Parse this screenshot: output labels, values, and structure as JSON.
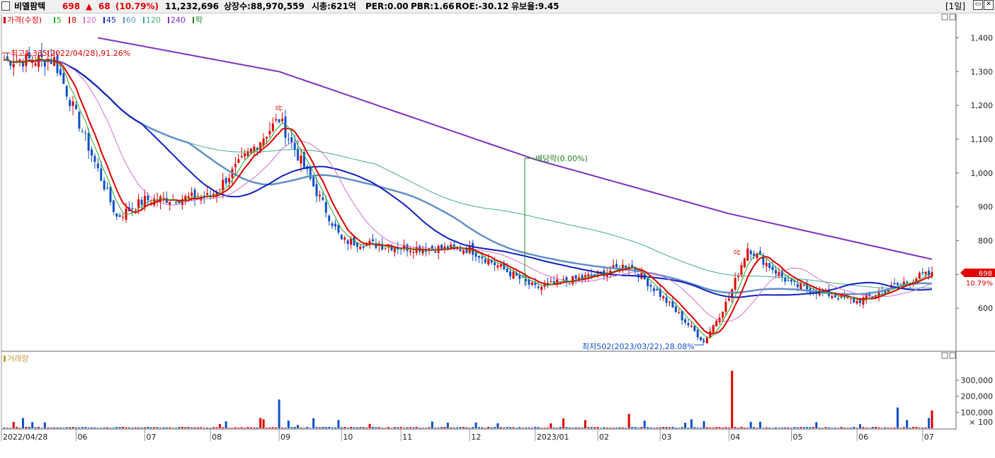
{
  "header": {
    "stock_name": "비엘팜텍",
    "price": "698",
    "change_symbol": "▲",
    "change": "68",
    "change_pct": "(10.79%)",
    "volume": "11,232,696",
    "listed_shares": "상장수:88,970,559",
    "market_cap": "시총:621억",
    "per": "PER:0.00",
    "pbr": "PBR:1.66",
    "roe": "ROE:-30.12",
    "float_ratio": "유보율:9.45",
    "period": "[1일]",
    "colors": {
      "up": "#e00000",
      "down": "#1050c8",
      "text": "#000000"
    }
  },
  "legend_price": {
    "label": "가격(수정)",
    "items": [
      {
        "label": "5",
        "color": "#22aa22"
      },
      {
        "label": "8",
        "color": "#e00000"
      },
      {
        "label": "20",
        "color": "#d070d0"
      },
      {
        "label": "45",
        "color": "#1020c0"
      },
      {
        "label": "60",
        "color": "#6090c8"
      },
      {
        "label": "120",
        "color": "#40b080"
      },
      {
        "label": "240",
        "color": "#8030c0"
      },
      {
        "label": "락",
        "color": "#208020"
      }
    ]
  },
  "legend_volume": {
    "label": "거래량"
  },
  "annotations": {
    "high": "최고1,335(2022/04/28),91.26%",
    "low": "최저502(2023/03/22),28.08%",
    "dividend": "배당락(0.00%)",
    "marker1": "상",
    "marker2": "상"
  },
  "price_tag": {
    "price": "698",
    "pct": "10.79%"
  },
  "chart_data": [
    {
      "type": "candlestick",
      "title": "",
      "y_ticks": [
        600,
        700,
        800,
        900,
        1000,
        1100,
        1200,
        1300,
        1400
      ],
      "ylim": [
        475,
        1470
      ],
      "x_tick_labels": [
        "2022/04/28",
        "06",
        "07",
        "08",
        "09",
        "10",
        "11",
        "12",
        "2023/01",
        "02",
        "03",
        "04",
        "05",
        "06",
        "07"
      ],
      "grid": false,
      "key_points": [
        {
          "date": "2022/04/28",
          "close": 1335
        },
        {
          "date": "2022/06",
          "close": 1170
        },
        {
          "date": "2022/06/20",
          "close": 870
        },
        {
          "date": "2022/07",
          "close": 920
        },
        {
          "date": "2022/08",
          "close": 930
        },
        {
          "date": "2022/09",
          "close": 1160
        },
        {
          "date": "2022/10",
          "close": 800
        },
        {
          "date": "2022/11",
          "close": 780
        },
        {
          "date": "2022/12",
          "close": 775
        },
        {
          "date": "2023/01",
          "close": 660
        },
        {
          "date": "2023/02",
          "close": 700
        },
        {
          "date": "2023/02/15",
          "close": 730
        },
        {
          "date": "2023/03",
          "close": 640
        },
        {
          "date": "2023/03/22",
          "close": 502
        },
        {
          "date": "2023/04",
          "close": 630
        },
        {
          "date": "2023/04/10",
          "close": 780
        },
        {
          "date": "2023/05",
          "close": 670
        },
        {
          "date": "2023/06",
          "close": 620
        },
        {
          "date": "2023/07",
          "close": 698
        }
      ],
      "ma_last": {
        "ma240": 745,
        "ma120": 690,
        "ma60": 670,
        "ma45": 658
      }
    },
    {
      "type": "bar",
      "title": "",
      "y_ticks": [
        100000,
        200000,
        300000
      ],
      "unit": "× 100",
      "ylim": [
        0,
        380000
      ],
      "x_tick_labels": [
        "2022/04/28",
        "06",
        "07",
        "08",
        "09",
        "10",
        "11",
        "12",
        "2023/01",
        "02",
        "03",
        "04",
        "05",
        "06",
        "07"
      ],
      "spikes": [
        {
          "date": "2022/09/01",
          "value": 180000
        },
        {
          "date": "2023/02/15",
          "value": 90000
        },
        {
          "date": "2023/04/03",
          "value": 360000
        },
        {
          "date": "2023/06/20",
          "value": 130000
        },
        {
          "date": "2023/07/05",
          "value": 112000
        }
      ]
    }
  ]
}
